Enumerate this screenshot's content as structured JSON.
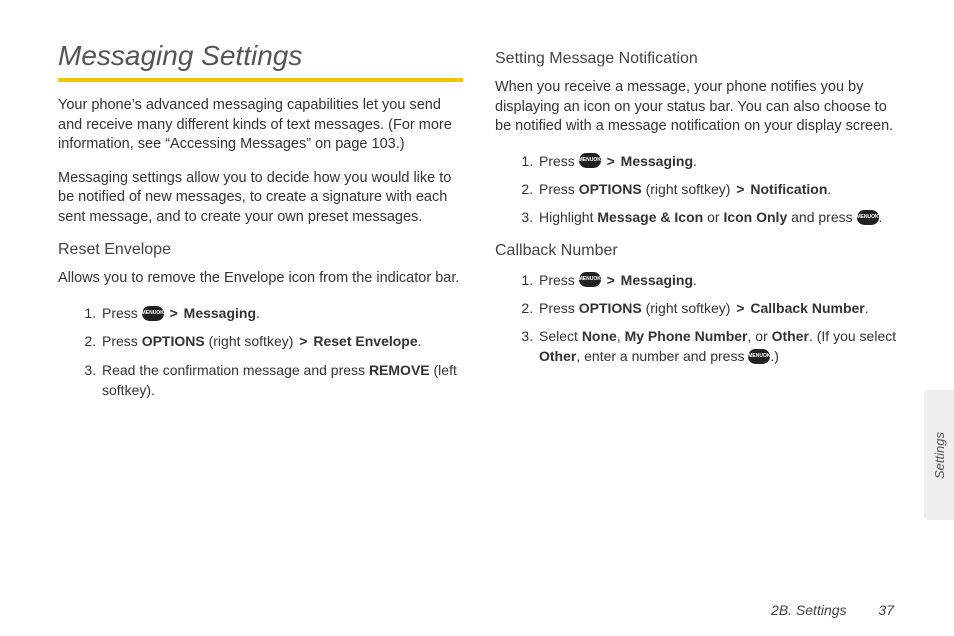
{
  "title": "Messaging Settings",
  "intro1": "Your phone’s advanced messaging capabilities let you send and receive many different kinds of text messages. (For more information, see “Accessing Messages” on page 103.)",
  "intro2": "Messaging settings allow you to decide how you would like to be notified of new messages, to create a signature with each sent message, and to create your own preset messages.",
  "reset": {
    "heading": "Reset Envelope",
    "desc": "Allows you to remove the Envelope icon from the indicator bar.",
    "step1_pre": "Press ",
    "step1_link": "Messaging",
    "step2_pre": "Press ",
    "step2_opt": "OPTIONS",
    "step2_mid": " (right softkey) ",
    "step2_link": "Reset Envelope",
    "step3_a": "Read the confirmation message and press ",
    "step3_b": "REMOVE",
    "step3_c": " (left softkey)."
  },
  "notify": {
    "heading": "Setting Message Notification",
    "desc": "When you receive a message, your phone notifies you by displaying an icon on your status bar. You can also choose to be notified with a message notification on your display screen.",
    "step1_pre": "Press ",
    "step1_link": "Messaging",
    "step2_pre": "Press ",
    "step2_opt": "OPTIONS",
    "step2_mid": " (right softkey) ",
    "step2_link": "Notification",
    "step3_a": "Highlight ",
    "step3_b": "Message & Icon",
    "step3_c": " or ",
    "step3_d": "Icon Only",
    "step3_e": " and press "
  },
  "callback": {
    "heading": "Callback Number",
    "step1_pre": "Press ",
    "step1_link": "Messaging",
    "step2_pre": "Press ",
    "step2_opt": "OPTIONS",
    "step2_mid": " (right softkey) ",
    "step2_link": "Callback Number",
    "step3_a": "Select ",
    "step3_b": "None",
    "step3_c": ", ",
    "step3_d": "My Phone Number",
    "step3_e": ", or ",
    "step3_f": "Other",
    "step3_g": ". (If you select ",
    "step3_h": "Other",
    "step3_i": ", enter a number and press ",
    "step3_j": ".)"
  },
  "gt": ">",
  "period": ".",
  "sidetab": "Settings",
  "footer_section": "2B. Settings",
  "footer_page": "37",
  "menuok_top": "MENU",
  "menuok_bot": "OK"
}
